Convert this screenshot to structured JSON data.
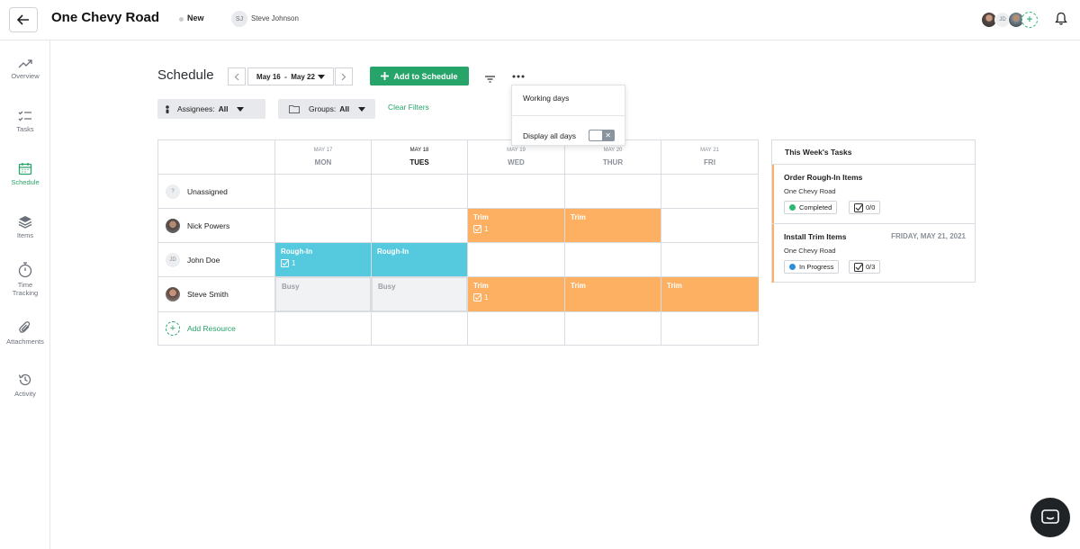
{
  "header": {
    "project_title": "One Chevy Road",
    "status": "New",
    "owner_initials": "SJ",
    "owner_name": "Steve Johnson",
    "team_initials": "JD",
    "add_member": "+"
  },
  "sidebar": {
    "items": [
      {
        "label": "Overview",
        "icon": "trend-icon"
      },
      {
        "label": "Tasks",
        "icon": "tasks-icon"
      },
      {
        "label": "Schedule",
        "icon": "calendar-icon"
      },
      {
        "label": "Items",
        "icon": "layers-icon"
      },
      {
        "label": "Time Tracking",
        "icon": "stopwatch-icon"
      },
      {
        "label": "Attachments",
        "icon": "paperclip-icon"
      },
      {
        "label": "Activity",
        "icon": "history-icon"
      }
    ]
  },
  "toolbar": {
    "title": "Schedule",
    "date_range": "May 16  -  May 22",
    "add_label": "Add to Schedule",
    "assignees_label": "Assignees:",
    "assignees_value": "All",
    "groups_label": "Groups:",
    "groups_value": "All",
    "clear_filters": "Clear Filters"
  },
  "menu": {
    "working_days": "Working days",
    "display_all_days": "Display all days",
    "toggle_off": "✕"
  },
  "days": [
    {
      "date": "MAY 17",
      "name": "MON"
    },
    {
      "date": "MAY 18",
      "name": "TUES"
    },
    {
      "date": "MAY 19",
      "name": "WED"
    },
    {
      "date": "MAY 20",
      "name": "THUR"
    },
    {
      "date": "MAY 21",
      "name": "FRI"
    }
  ],
  "resources": [
    {
      "name": "Unassigned",
      "initials": "?"
    },
    {
      "name": "Nick Powers",
      "initials": ""
    },
    {
      "name": "John Doe",
      "initials": "JD"
    },
    {
      "name": "Steve Smith",
      "initials": ""
    }
  ],
  "add_resource": "Add Resource",
  "blocks": {
    "rough_in": "Rough-In",
    "trim": "Trim",
    "busy": "Busy",
    "count_one": "1"
  },
  "this_week": {
    "title": "This Week's Tasks",
    "tasks": [
      {
        "title": "Order Rough-In Items",
        "project": "One Chevy Road",
        "status": "Completed",
        "status_color": "#2fb872",
        "checklist": "0/0",
        "date": ""
      },
      {
        "title": "Install Trim Items",
        "project": "One Chevy Road",
        "status": "In Progress",
        "status_color": "#2f8fd6",
        "checklist": "0/3",
        "date": "FRIDAY, MAY 21, 2021"
      }
    ]
  },
  "colors": {
    "accent": "#27a469",
    "rough_in": "#55c9de",
    "trim": "#fdb062"
  }
}
